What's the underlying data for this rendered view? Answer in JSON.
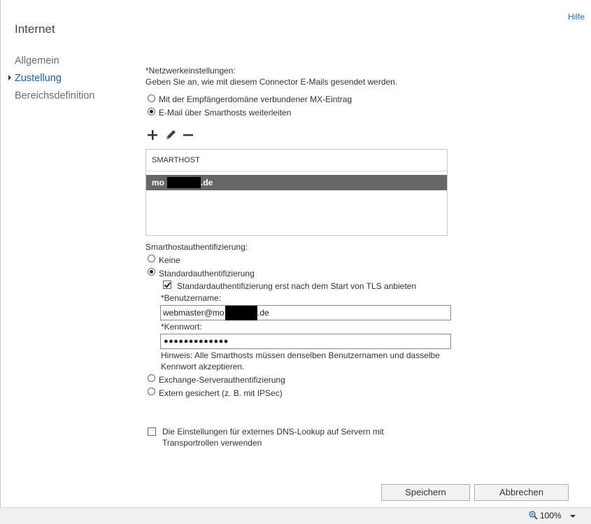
{
  "header": {
    "help_label": "Hilfe",
    "title": "Internet"
  },
  "nav": {
    "items": [
      {
        "label": "Allgemein",
        "active": false
      },
      {
        "label": "Zustellung",
        "active": true
      },
      {
        "label": "Bereichsdefinition",
        "active": false
      }
    ]
  },
  "network": {
    "label": "*Netzwerkeinstellungen:",
    "description": "Geben Sie an, wie mit diesem Connector E-Mails gesendet werden.",
    "option_mx": "Mit der Empfängerdomäne verbundener MX-Eintrag",
    "option_smarthost": "E-Mail über Smarthosts weiterleiten",
    "selected": "option_smarthost"
  },
  "toolbar": {
    "add_icon": "plus-icon",
    "edit_icon": "pencil-icon",
    "remove_icon": "minus-icon"
  },
  "smarthost_list": {
    "column_header": "SMARTHOST",
    "rows": [
      {
        "prefix": "mo",
        "suffix": ".de",
        "selected": true
      }
    ]
  },
  "auth": {
    "label": "Smarthostauthentifizierung:",
    "option_none": "Keine",
    "option_basic": "Standardauthentifizierung",
    "tls_checkbox_label": "Standardauthentifizierung erst nach dem Start von TLS anbieten",
    "tls_checked": true,
    "username_label": "*Benutzername:",
    "username_prefix": "webmaster@mo",
    "username_suffix": ".de",
    "password_label": "*Kennwort:",
    "password_masked": "●●●●●●●●●●●●●",
    "hint": "Hinweis: Alle Smarthosts müssen denselben Benutzernamen und dasselbe",
    "hint_line2": "Kennwort akzeptieren.",
    "option_exchange": "Exchange-Serverauthentifizierung",
    "option_external": "Extern gesichert (z. B. mit IPSec)",
    "selected": "option_basic"
  },
  "dns": {
    "label_line1": "Die Einstellungen für externes DNS-Lookup auf Servern mit",
    "label_line2": "Transportrollen verwenden",
    "checked": false
  },
  "buttons": {
    "save": "Speichern",
    "cancel": "Abbrechen"
  },
  "status": {
    "zoom": "100%",
    "zoom_icon": "zoom-icon"
  }
}
